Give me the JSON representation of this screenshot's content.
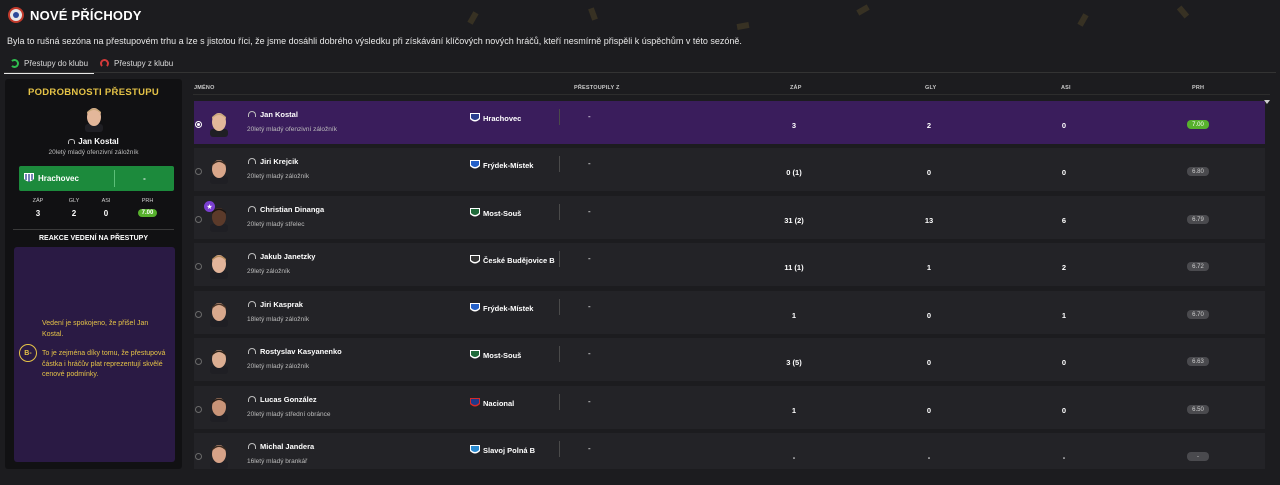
{
  "header": {
    "title": "NOVÉ PŘÍCHODY",
    "description": "Byla to rušná sezóna na přestupovém trhu a lze s jistotou říci, že jsme dosáhli dobrého výsledku při získávání klíčových nových hráčů, kteří nesmírně přispěli k úspěchům v této sezóně."
  },
  "tabs": [
    {
      "label": "Přestupy do klubu",
      "active": true,
      "icon": "arrow-in-icon"
    },
    {
      "label": "Přestupy z klubu",
      "active": false,
      "icon": "arrow-out-icon"
    }
  ],
  "detail": {
    "title": "PODROBNOSTI PŘESTUPU",
    "name": "Jan Kostal",
    "role": "20letý mladý ofenzivní záložník",
    "club": "Hrachovec",
    "fee": "-",
    "stats": [
      {
        "label": "ZÁP",
        "value": "3"
      },
      {
        "label": "GLY",
        "value": "2"
      },
      {
        "label": "ASI",
        "value": "0"
      },
      {
        "label": "PRH",
        "value": "7.00"
      }
    ],
    "reaction_title": "REAKCE VEDENÍ NA PŘESTUPY",
    "grade": "B-",
    "reaction_paragraphs": [
      "Vedení je spokojeno, že přišel Jan Kostal.",
      "To je zejména díky tomu, že přestupová částka i hráčův plat reprezentují skvělé cenové podmínky."
    ]
  },
  "table": {
    "columns": {
      "name": "JMÉNO",
      "from": "PŘESTOUPILY Z",
      "apps": "ZÁP",
      "goals": "GLY",
      "assists": "ASI",
      "rating": "PRH"
    },
    "rows": [
      {
        "name": "Jan Kostal",
        "role": "20letý mladý ofenzivní záložník",
        "club": "Hrachovec",
        "club_colors": [
          "#2b3f8f",
          "#ffffff"
        ],
        "fee": "-",
        "apps": "3",
        "goals": "2",
        "assists": "0",
        "rating": "7.00",
        "selected": true,
        "star": false,
        "skin": "#e3b79a",
        "hair": "#c9a77a"
      },
      {
        "name": "Jiri Krejcik",
        "role": "20letý mladý záložník",
        "club": "Frýdek-Místek",
        "club_colors": [
          "#2460c8",
          "#ffffff"
        ],
        "fee": "-",
        "apps": "0 (1)",
        "goals": "0",
        "assists": "0",
        "rating": "6.80",
        "selected": false,
        "star": false,
        "skin": "#d9a68a",
        "hair": "#3a2a20"
      },
      {
        "name": "Christian Dinanga",
        "role": "20letý mladý střelec",
        "club": "Most-Souš",
        "club_colors": [
          "#1f6a3a",
          "#ffffff"
        ],
        "fee": "-",
        "apps": "31 (2)",
        "goals": "13",
        "assists": "6",
        "rating": "6.79",
        "selected": false,
        "star": true,
        "skin": "#5b3a2a",
        "hair": "#1a1410"
      },
      {
        "name": "Jakub Janetzky",
        "role": "29letý záložník",
        "club": "České Budějovice B",
        "club_colors": [
          "#333333",
          "#ffffff"
        ],
        "fee": "-",
        "apps": "11 (1)",
        "goals": "1",
        "assists": "2",
        "rating": "6.72",
        "selected": false,
        "star": false,
        "skin": "#e2b49a",
        "hair": "#b38a5a"
      },
      {
        "name": "Jiri Kasprak",
        "role": "18letý mladý záložník",
        "club": "Frýdek-Místek",
        "club_colors": [
          "#2460c8",
          "#ffffff"
        ],
        "fee": "-",
        "apps": "1",
        "goals": "0",
        "assists": "1",
        "rating": "6.70",
        "selected": false,
        "star": false,
        "skin": "#d8a88c",
        "hair": "#4a3426"
      },
      {
        "name": "Rostyslav Kasyanenko",
        "role": "20letý mladý záložník",
        "club": "Most-Souš",
        "club_colors": [
          "#1f6a3a",
          "#ffffff"
        ],
        "fee": "-",
        "apps": "3 (5)",
        "goals": "0",
        "assists": "0",
        "rating": "6.63",
        "selected": false,
        "star": false,
        "skin": "#dcae92",
        "hair": "#2e2218"
      },
      {
        "name": "Lucas González",
        "role": "20letý mladý střední obránce",
        "club": "Nacional",
        "club_colors": [
          "#1e3a8a",
          "#d42a2a"
        ],
        "fee": "-",
        "apps": "1",
        "goals": "0",
        "assists": "0",
        "rating": "6.50",
        "selected": false,
        "star": false,
        "skin": "#c99478",
        "hair": "#2a1e16"
      },
      {
        "name": "Michal Jandera",
        "role": "16letý mladý brankář",
        "club": "Slavoj Polná B",
        "club_colors": [
          "#2a8ad0",
          "#ffffff"
        ],
        "fee": "-",
        "apps": "-",
        "goals": "-",
        "assists": "-",
        "rating": "-",
        "selected": false,
        "star": false,
        "skin": "#d6a288",
        "hair": "#3a2a1e"
      }
    ]
  }
}
